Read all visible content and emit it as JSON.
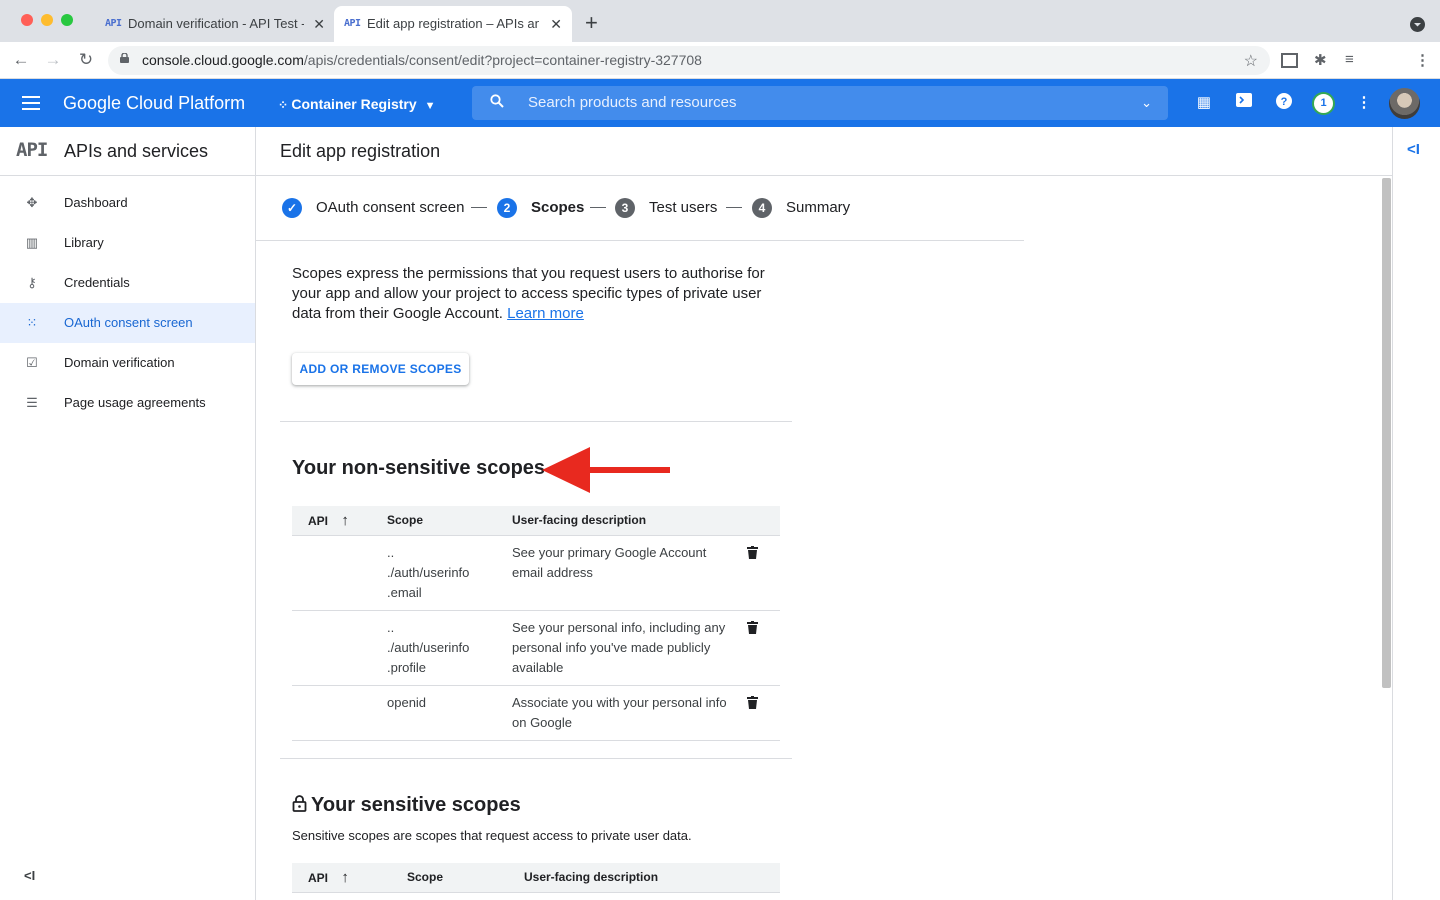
{
  "browser": {
    "tabs": [
      {
        "favicon": "API",
        "title": "Domain verification - API Test -",
        "close": "✕"
      },
      {
        "favicon": "API",
        "title": "Edit app registration – APIs and",
        "close": "✕"
      }
    ],
    "new_tab": "+",
    "url_host": "console.cloud.google.com",
    "url_path": "/apis/credentials/consent/edit?project=container-registry-327708"
  },
  "header": {
    "brand": "Google Cloud Platform",
    "project": "Container Registry",
    "search_placeholder": "Search products and resources",
    "notification_count": "1"
  },
  "sidebar": {
    "logo": "API",
    "title": "APIs and services",
    "items": [
      {
        "label": "Dashboard",
        "icon": "dashboard-icon",
        "active": false
      },
      {
        "label": "Library",
        "icon": "library-icon",
        "active": false
      },
      {
        "label": "Credentials",
        "icon": "key-icon",
        "active": false
      },
      {
        "label": "OAuth consent screen",
        "icon": "consent-icon",
        "active": true
      },
      {
        "label": "Domain verification",
        "icon": "checkbox-icon",
        "active": false
      },
      {
        "label": "Page usage agreements",
        "icon": "settings-list-icon",
        "active": false
      }
    ],
    "collapse": "<I"
  },
  "main": {
    "title": "Edit app registration",
    "steps": [
      {
        "num": "✓",
        "label": "OAuth consent screen",
        "state": "done"
      },
      {
        "num": "2",
        "label": "Scopes",
        "state": "active"
      },
      {
        "num": "3",
        "label": "Test users",
        "state": "pending"
      },
      {
        "num": "4",
        "label": "Summary",
        "state": "pending"
      }
    ],
    "description": "Scopes express the permissions that you request users to authorise for your app and allow your project to access specific types of private user data from their Google Account.",
    "learn_more": "Learn more",
    "add_remove_button": "ADD OR REMOVE SCOPES",
    "non_sensitive": {
      "title": "Your non-sensitive scopes",
      "columns": [
        "API",
        "Scope",
        "User-facing description"
      ],
      "rows": [
        {
          "api": "",
          "scope_lines": [
            "..",
            "./auth/userinfo",
            ".email"
          ],
          "description": "See your primary Google Account email address"
        },
        {
          "api": "",
          "scope_lines": [
            "..",
            "./auth/userinfo",
            ".profile"
          ],
          "description": "See your personal info, including any personal info you've made publicly available"
        },
        {
          "api": "",
          "scope_lines": [
            "openid"
          ],
          "description": "Associate you with your personal info on Google"
        }
      ]
    },
    "sensitive": {
      "title": "Your sensitive scopes",
      "note": "Sensitive scopes are scopes that request access to private user data.",
      "columns": [
        "API",
        "Scope",
        "User-facing description"
      ]
    }
  },
  "colors": {
    "primary": "#1a73e8",
    "annotation_arrow": "#e8291f"
  }
}
